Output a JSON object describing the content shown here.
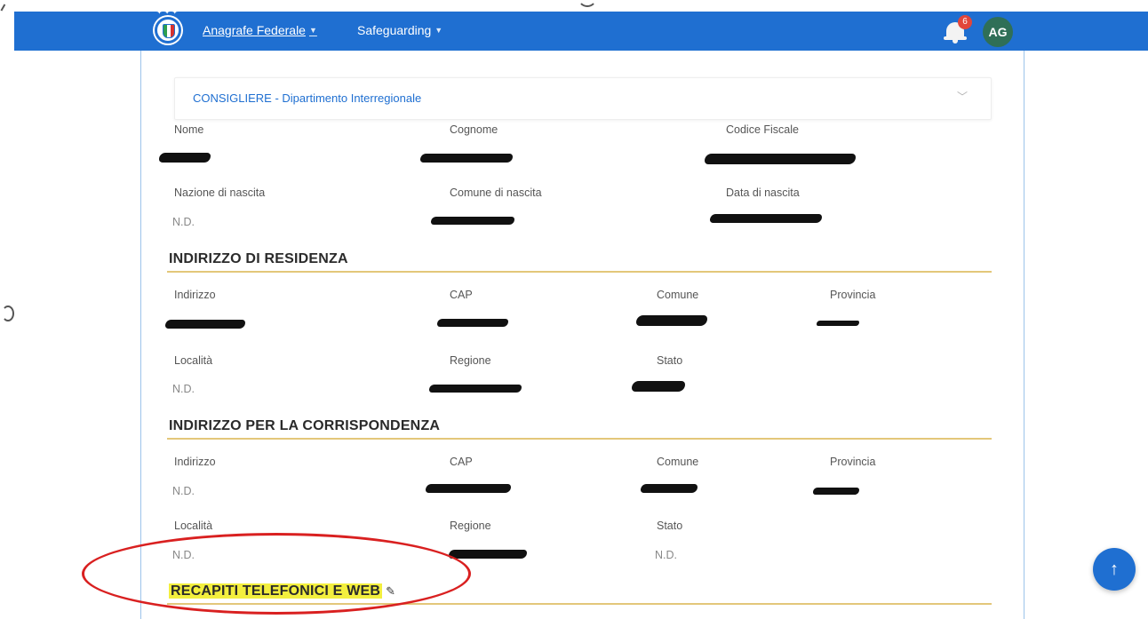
{
  "navbar": {
    "menu": [
      {
        "label": "Anagrafe Federale"
      },
      {
        "label": "Safeguarding"
      }
    ],
    "notification_count": "6",
    "avatar_initials": "AG",
    "color": "#1f6fd1"
  },
  "accordion": {
    "title": "CONSIGLIERE - Dipartimento Interregionale"
  },
  "personal": {
    "nome_label": "Nome",
    "cognome_label": "Cognome",
    "codice_fiscale_label": "Codice Fiscale",
    "nazione_label": "Nazione di nascita",
    "nazione_value": "N.D.",
    "comune_label": "Comune di nascita",
    "data_label": "Data di nascita"
  },
  "residenza": {
    "title": "INDIRIZZO DI RESIDENZA",
    "indirizzo_label": "Indirizzo",
    "cap_label": "CAP",
    "comune_label": "Comune",
    "provincia_label": "Provincia",
    "localita_label": "Località",
    "localita_value": "N.D.",
    "regione_label": "Regione",
    "stato_label": "Stato"
  },
  "corrispondenza": {
    "title": "INDIRIZZO PER LA CORRISPONDENZA",
    "indirizzo_label": "Indirizzo",
    "indirizzo_value": "N.D.",
    "cap_label": "CAP",
    "comune_label": "Comune",
    "provincia_label": "Provincia",
    "localita_label": "Località",
    "localita_value": "N.D.",
    "regione_label": "Regione",
    "stato_label": "Stato",
    "stato_value": "N.D."
  },
  "recapiti": {
    "title": "RECAPITI TELEFONICI E WEB",
    "edit_icon": "pencil-icon",
    "highlight_color": "#f3ef3e",
    "annotation_color": "#d92020"
  },
  "icons": {
    "scroll_top": "arrow-up-icon",
    "notifications": "bell-icon",
    "accordion_toggle": "chevron-down-icon"
  }
}
